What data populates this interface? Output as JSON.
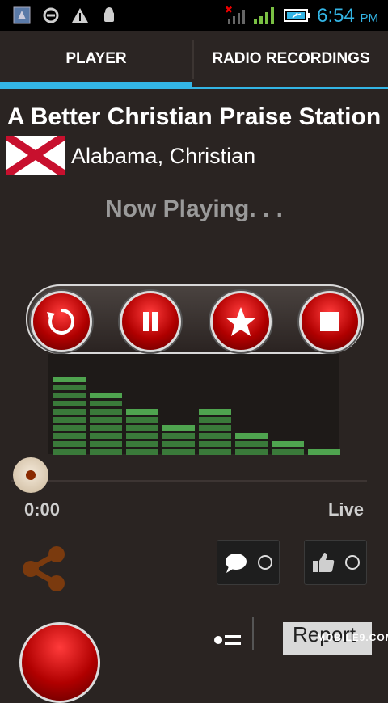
{
  "status_bar": {
    "time": "6:54",
    "ampm": "PM",
    "icons": [
      "app-thumbnail-icon",
      "sync-icon",
      "warning-icon",
      "android-debug-icon",
      "signal-no-data-icon",
      "signal-bars-icon",
      "battery-charging-icon"
    ]
  },
  "tabs": [
    {
      "label": "PLAYER"
    },
    {
      "label": "RADIO RECORDINGS"
    }
  ],
  "station": {
    "title": "A Better Christian Praise Station",
    "meta": "Alabama,  Christian"
  },
  "player": {
    "now_playing": "Now Playing. . .",
    "controls": [
      "refresh-icon",
      "pause-icon",
      "star-icon",
      "stop-icon"
    ],
    "time_current": "0:00",
    "time_live": "Live"
  },
  "equalizer": {
    "levels": [
      9,
      7,
      5,
      3,
      5,
      2,
      1,
      0
    ]
  },
  "bottom": {
    "comment_count": "",
    "like_count": "",
    "report_label": "Report"
  },
  "watermark": "MOBILE9.COM",
  "colors": {
    "accent": "#33b5e5",
    "button_red": "#c00000",
    "eq_green": "#3a7a3a"
  }
}
